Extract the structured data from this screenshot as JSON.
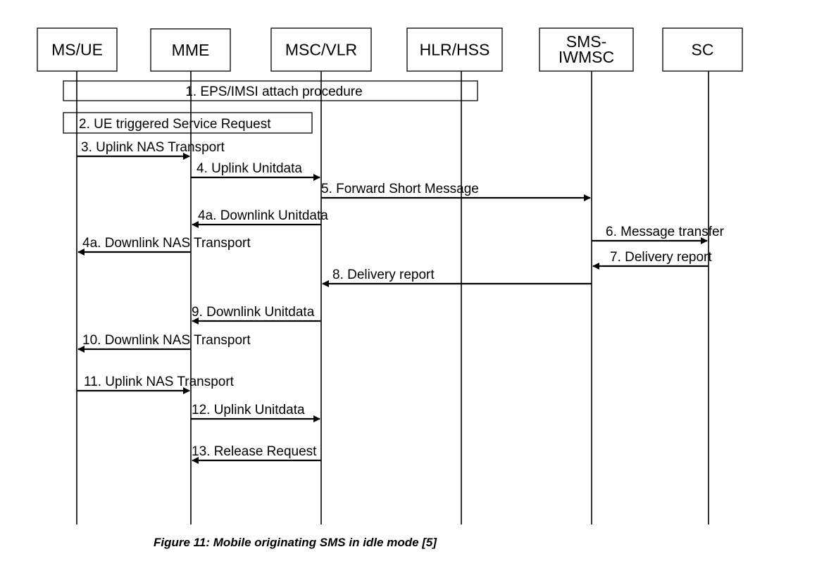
{
  "entities": [
    {
      "id": "ue",
      "label": [
        "MS/UE"
      ]
    },
    {
      "id": "mme",
      "label": [
        "MME"
      ]
    },
    {
      "id": "msc",
      "label": [
        "MSC/VLR"
      ]
    },
    {
      "id": "hlr",
      "label": [
        "HLR/HSS"
      ]
    },
    {
      "id": "iwmsc",
      "label": [
        "SMS-",
        "IWMSC"
      ]
    },
    {
      "id": "sc",
      "label": [
        "SC"
      ]
    }
  ],
  "procedures": [
    {
      "label": "1. EPS/IMSI attach procedure",
      "from": "ue",
      "to": "hlr"
    },
    {
      "label": "2. UE triggered Service Request",
      "from": "ue",
      "to": "msc"
    }
  ],
  "messages": [
    {
      "label": "3. Uplink NAS Transport",
      "from": "ue",
      "to": "mme"
    },
    {
      "label": "4. Uplink Unitdata",
      "from": "mme",
      "to": "msc"
    },
    {
      "label": "5. Forward Short Message",
      "from": "msc",
      "to": "iwmsc"
    },
    {
      "label": "4a. Downlink Unitdata",
      "from": "msc",
      "to": "mme"
    },
    {
      "label": "4a. Downlink NAS Transport",
      "from": "mme",
      "to": "ue"
    },
    {
      "label": "6. Message transfer",
      "from": "iwmsc",
      "to": "sc"
    },
    {
      "label": "7. Delivery report",
      "from": "sc",
      "to": "iwmsc"
    },
    {
      "label": "8. Delivery report",
      "from": "iwmsc",
      "to": "msc"
    },
    {
      "label": "9. Downlink Unitdata",
      "from": "msc",
      "to": "mme"
    },
    {
      "label": "10. Downlink NAS Transport",
      "from": "mme",
      "to": "ue"
    },
    {
      "label": "11. Uplink NAS Transport",
      "from": "ue",
      "to": "mme"
    },
    {
      "label": "12. Uplink Unitdata",
      "from": "mme",
      "to": "msc"
    },
    {
      "label": "13. Release Request",
      "from": "msc",
      "to": "mme"
    }
  ],
  "caption": "Figure 11: Mobile originating SMS in idle mode [5]"
}
